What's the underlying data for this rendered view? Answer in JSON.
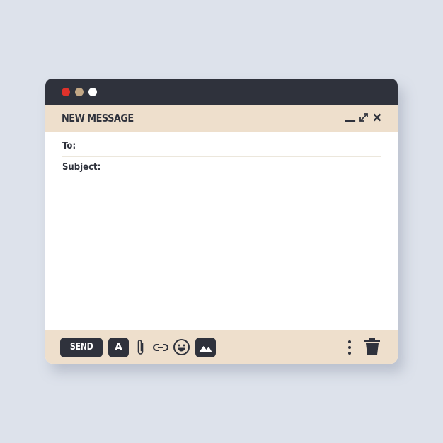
{
  "window": {
    "title": "NEW MESSAGE",
    "controls": {
      "minimize_icon": "minimize-icon",
      "maximize_icon": "expand-icon",
      "close_icon": "close-icon"
    },
    "traffic_lights": [
      "#e0322b",
      "#c3a886",
      "#ffffff"
    ]
  },
  "fields": {
    "to_label": "To:",
    "to_value": "",
    "subject_label": "Subject:",
    "subject_value": ""
  },
  "body": {
    "value": ""
  },
  "toolbar": {
    "send_label": "SEND",
    "format_label": "A",
    "icons": [
      "paperclip-icon",
      "link-icon",
      "emoji-icon",
      "image-icon",
      "more-vertical-icon",
      "trash-icon"
    ]
  },
  "colors": {
    "dark": "#2f323c",
    "accent_bg": "#eedfcc",
    "page_bg": "#dde2eb"
  }
}
